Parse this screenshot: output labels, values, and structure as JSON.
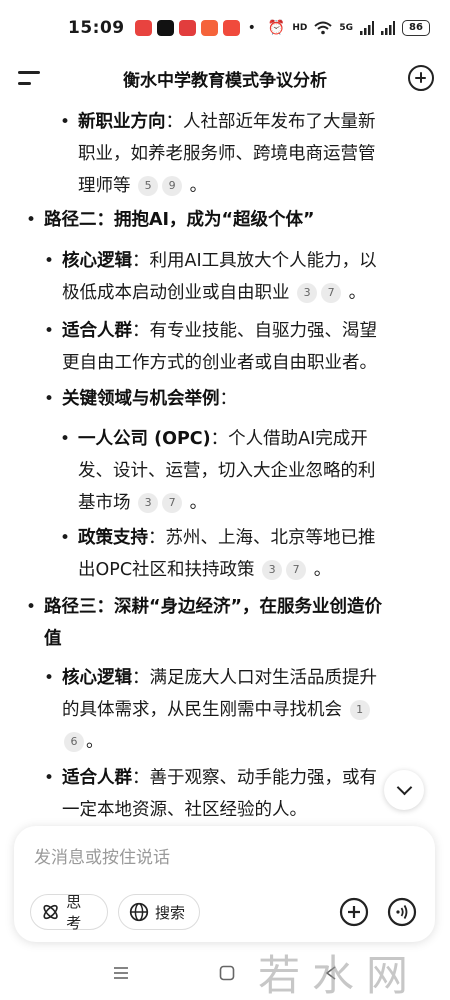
{
  "status_bar": {
    "time": "15:09",
    "dot": "•",
    "battery": "86",
    "network_label": "5G",
    "hd_label": "HD"
  },
  "header": {
    "title": "衡水中学教育模式争议分析"
  },
  "content": {
    "job_direction": {
      "label": "新职业方向",
      "text_line1": "：人社部近年发布了大量新",
      "text_line2": "职业，如养老服务师、跨境电商运营管",
      "text_line3": "理师等",
      "citations": [
        "5",
        "9"
      ],
      "end": "。"
    },
    "path2": {
      "label": "路径二：拥抱AI，成为“超级个体”"
    },
    "path2_logic": {
      "label": "核心逻辑",
      "text_line1": "：利用AI工具放大个人能力，以",
      "text_line2": "极低成本启动创业或自由职业",
      "citations": [
        "3",
        "7"
      ],
      "end": "。"
    },
    "path2_people": {
      "label": "适合人群",
      "text_line1": "：有专业技能、自驱力强、渴望",
      "text_line2": "更自由工作方式的创业者或自由职业者。"
    },
    "path2_fields": {
      "label": "关键领域与机会举例",
      "text": "："
    },
    "opc": {
      "label": "一人公司 (OPC)",
      "text_line1": "：个人借助AI完成开",
      "text_line2": "发、设计、运营，切入大企业忽略的利",
      "text_line3": "基市场",
      "citations": [
        "3",
        "7"
      ],
      "end": "。"
    },
    "policy": {
      "label": "政策支持",
      "text_line1": "：苏州、上海、北京等地已推",
      "text_line2": "出OPC社区和扶持政策",
      "citations": [
        "3",
        "7"
      ],
      "end": "。"
    },
    "path3": {
      "label_line1": "路径三：深耕“身边经济”，在服务业创造价",
      "label_line2": "值"
    },
    "path3_logic": {
      "label": "核心逻辑",
      "text_line1": "：满足庞大人口对生活品质提升",
      "text_line2": "的具体需求，从民生刚需中寻找机会",
      "citations": [
        "1",
        "6"
      ],
      "end": "。"
    },
    "path3_people": {
      "label": "适合人群",
      "text_line1": "：善于观察、动手能力强，或有",
      "text_line2": "一定本地资源、社区经验的人。"
    }
  },
  "input": {
    "placeholder": "发消息或按住说话",
    "think_label": "思考",
    "search_label": "搜索"
  },
  "watermark": "若水网",
  "icons": {
    "menu": "menu-icon",
    "new_chat": "plus-circle-icon",
    "scroll_down": "chevron-down-icon",
    "think": "atom-icon",
    "search": "globe-icon",
    "add": "plus-circle-icon",
    "voice": "voice-wave-icon"
  }
}
